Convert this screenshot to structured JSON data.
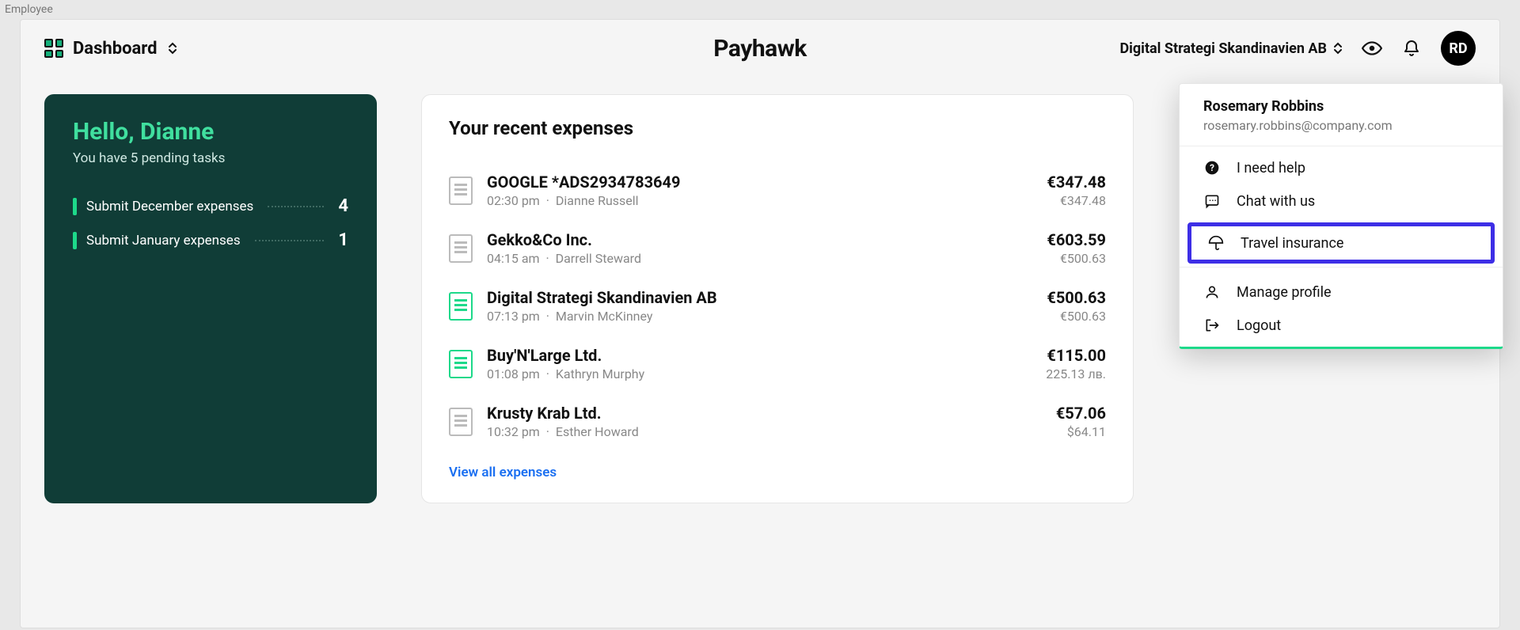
{
  "top_label": "Employee",
  "brand": "Payhawk",
  "page_title": "Dashboard",
  "company_name": "Digital Strategi Skandinavien AB",
  "avatar_initials": "RD",
  "greeting": {
    "title": "Hello, Dianne",
    "subtitle": "You have 5 pending tasks",
    "tasks": [
      {
        "label": "Submit December expenses",
        "count": "4"
      },
      {
        "label": "Submit January expenses",
        "count": "1"
      }
    ]
  },
  "expenses": {
    "title": "Your recent expenses",
    "view_all": "View all expenses",
    "rows": [
      {
        "vendor": "GOOGLE *ADS2934783649",
        "time": "02:30 pm",
        "user": "Dianne Russell",
        "amount": "€347.48",
        "sub": "€347.48",
        "iconGreen": false
      },
      {
        "vendor": "Gekko&Co Inc.",
        "time": "04:15 am",
        "user": "Darrell Steward",
        "amount": "€603.59",
        "sub": "€500.63",
        "iconGreen": false
      },
      {
        "vendor": "Digital Strategi Skandinavien AB",
        "time": "07:13 pm",
        "user": "Marvin McKinney",
        "amount": "€500.63",
        "sub": "€500.63",
        "iconGreen": true
      },
      {
        "vendor": "Buy'N'Large Ltd.",
        "time": "01:08 pm",
        "user": "Kathryn Murphy",
        "amount": "€115.00",
        "sub": "225.13 лв.",
        "iconGreen": true
      },
      {
        "vendor": "Krusty Krab Ltd.",
        "time": "10:32 pm",
        "user": "Esther Howard",
        "amount": "€57.06",
        "sub": "$64.11",
        "iconGreen": false
      }
    ]
  },
  "user_menu": {
    "name": "Rosemary Robbins",
    "email": "rosemary.robbins@company.com",
    "items1": [
      {
        "key": "help",
        "label": "I need help"
      },
      {
        "key": "chat",
        "label": "Chat with us"
      }
    ],
    "highlight": {
      "key": "travel",
      "label": "Travel insurance"
    },
    "items2": [
      {
        "key": "profile",
        "label": "Manage profile"
      },
      {
        "key": "logout",
        "label": "Logout"
      }
    ]
  }
}
